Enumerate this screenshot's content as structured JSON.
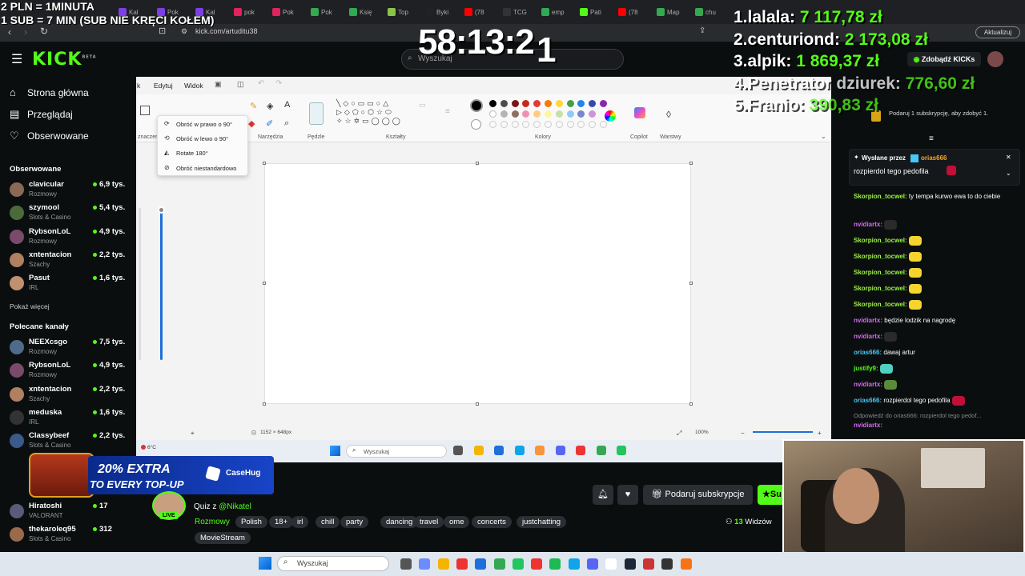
{
  "overlay": {
    "line1": "2 PLN = 1MINUTA",
    "line2": "1 SUB = 7 MIN (SUB NIE KRĘCI KOŁEM)",
    "timer": "58:13:2",
    "timer_last": "1",
    "leaderboard": [
      {
        "rank": "1.",
        "name": "lalala:",
        "value": "7 117,78 zł"
      },
      {
        "rank": "2.",
        "name": "centuriond:",
        "value": "2 173,08 zł"
      },
      {
        "rank": "3.",
        "name": "alpik:",
        "value": "1 869,37 zł"
      },
      {
        "rank": "4.",
        "name": "Penetrator dziurek:",
        "value": "776,60 zł"
      },
      {
        "rank": "5.",
        "name": "Franio:",
        "value": "390,83 zł"
      }
    ]
  },
  "browser": {
    "url": "kick.com/artuditu38",
    "update_label": "Aktualizuj",
    "tabs": [
      {
        "label": "Kal",
        "color": "#7b3fe4"
      },
      {
        "label": "Pok",
        "color": "#7b3fe4"
      },
      {
        "label": "Kal",
        "color": "#7b3fe4"
      },
      {
        "label": "pok",
        "color": "#e0245e"
      },
      {
        "label": "Pok",
        "color": "#e0245e"
      },
      {
        "label": "Pok",
        "color": "#34a853"
      },
      {
        "label": "Księ",
        "color": "#34a853"
      },
      {
        "label": "Top",
        "color": "#8bc34a"
      },
      {
        "label": "Byki",
        "color": "#222222"
      },
      {
        "label": "(78",
        "color": "#ff0000"
      },
      {
        "label": "TCG",
        "color": "#333333"
      },
      {
        "label": "emp",
        "color": "#34a853"
      },
      {
        "label": "Pati",
        "color": "#53fc18"
      },
      {
        "label": "(78",
        "color": "#ff0000"
      },
      {
        "label": "Map",
        "color": "#34a853"
      },
      {
        "label": "chu",
        "color": "#34a853"
      }
    ]
  },
  "kick": {
    "logo": "KICK",
    "logo_beta": "BETA",
    "search_placeholder": "Wyszukaj",
    "kicks_button": "Zdobądź KICKs",
    "nav": [
      {
        "label": "Strona główna",
        "icon": "home-icon"
      },
      {
        "label": "Przeglądaj",
        "icon": "browse-icon"
      },
      {
        "label": "Obserwowane",
        "icon": "heart-icon"
      }
    ],
    "followed_header": "Obserwowane",
    "followed": [
      {
        "name": "clavicular",
        "cat": "Rozmowy",
        "viewers": "6,9 tys.",
        "color": "#8a6a55"
      },
      {
        "name": "szymool",
        "cat": "Slots & Casino",
        "viewers": "5,4 tys.",
        "color": "#4a6a3a"
      },
      {
        "name": "RybsonLoL",
        "cat": "Rozmowy",
        "viewers": "4,9 tys.",
        "color": "#7a4a6a"
      },
      {
        "name": "xntentacion",
        "cat": "Szachy",
        "viewers": "2,2 tys.",
        "color": "#b08060"
      },
      {
        "name": "Pasut",
        "cat": "IRL",
        "viewers": "1,6 tys.",
        "color": "#c09070"
      }
    ],
    "show_more": "Pokaż więcej",
    "recommended_header": "Polecane kanały",
    "recommended": [
      {
        "name": "NEEXcsgo",
        "cat": "Rozmowy",
        "viewers": "7,5 tys.",
        "color": "#506a8a"
      },
      {
        "name": "RybsonLoL",
        "cat": "Rozmowy",
        "viewers": "4,9 tys.",
        "color": "#7a4a6a"
      },
      {
        "name": "xntentacion",
        "cat": "Szachy",
        "viewers": "2,2 tys.",
        "color": "#b08060"
      },
      {
        "name": "meduska",
        "cat": "IRL",
        "viewers": "1,6 tys.",
        "color": "#333333"
      },
      {
        "name": "Classybeef",
        "cat": "Slots & Casino",
        "viewers": "2,2 tys.",
        "color": "#3a5a8a"
      }
    ],
    "more_channels": [
      {
        "name": "Hiratoshi",
        "cat": "VALORANT",
        "viewers": "17",
        "color": "#5a5a7a"
      },
      {
        "name": "thekaroleq95",
        "cat": "Slots & Casino",
        "viewers": "312",
        "color": "#9a6a4a"
      }
    ]
  },
  "paint": {
    "menu": [
      "k",
      "Edytuj",
      "Widok"
    ],
    "sections": [
      "znaczen",
      "Narzędzia",
      "Pędzle",
      "Kształty",
      "Kolory",
      "Copilot",
      "Warstwy"
    ],
    "rotate_menu": [
      "Obróć w prawo o 90°",
      "Obróć w lewo o 90°",
      "Rotate 180°",
      "Obróć niestandardowo"
    ],
    "canvas_size": "1152 × 648px",
    "zoom": "100%",
    "temperature": "6°C",
    "taskbar_search": "Wyszukaj",
    "palette": [
      "#000000",
      "#4d4d4d",
      "#7a1616",
      "#c42b1c",
      "#e53935",
      "#f57c00",
      "#fdd835",
      "#43a047",
      "#1e88e5",
      "#3949ab",
      "#8e24aa",
      "#ffffff",
      "#b4b4b4",
      "#8d6e63",
      "#f48fb1",
      "#ffcc80",
      "#fff59d",
      "#c5e1a5",
      "#90caf9",
      "#7986cb",
      "#ce93d8"
    ]
  },
  "stream": {
    "promo_line1": "20% EXTRA",
    "promo_line2": "TO EVERY TOP-UP",
    "promo_brand": "CaseHug",
    "live": "LIVE",
    "quiz_prefix": "Quiz z ",
    "quiz_handle": "@Nikatel",
    "category": "Rozmowy",
    "tags": [
      "Polish",
      "18+",
      "irl",
      "chill",
      "party",
      "dancing",
      "travel",
      "ome",
      "concerts",
      "justchatting",
      "MovieStream"
    ],
    "viewers_count": "13",
    "viewers_label": " Widzów",
    "gift_label": "Podaruj subskrypcje",
    "sub_label": "Su"
  },
  "chat": {
    "sub_info": "Podaruj 1 subskrypcję, aby zdobyć 1.",
    "pinned_by_prefix": "Wysłane przez ",
    "pinned_by": "orias666",
    "pinned_text": "rozpierdol tego pedofila",
    "messages": [
      {
        "user": "Skorpion_tocwel:",
        "text": " ty tempa kurwo ewa to do ciebie",
        "color": "#9bf542"
      },
      {
        "user": "nvidiartx:",
        "text": "",
        "color": "#d26cf0",
        "emote": "#2a2a2a"
      },
      {
        "user": "Skorpion_tocwel:",
        "text": "",
        "color": "#9bf542",
        "emote": "#f5d430"
      },
      {
        "user": "Skorpion_tocwel:",
        "text": "",
        "color": "#9bf542",
        "emote": "#f5d430"
      },
      {
        "user": "Skorpion_tocwel:",
        "text": "",
        "color": "#9bf542",
        "emote": "#f5d430"
      },
      {
        "user": "Skorpion_tocwel:",
        "text": "",
        "color": "#9bf542",
        "emote": "#f5d430"
      },
      {
        "user": "Skorpion_tocwel:",
        "text": "",
        "color": "#9bf542",
        "emote": "#f5d430"
      },
      {
        "user": "nvidiartx:",
        "text": " będzie lodzik na nagrodę",
        "color": "#d26cf0"
      },
      {
        "user": "nvidiartx:",
        "text": "",
        "color": "#d26cf0",
        "emote": "#2a2a2a"
      },
      {
        "user": "orias666:",
        "text": " dawaj artur",
        "color": "#44c8f5"
      },
      {
        "user": "justify9:",
        "text": "",
        "color": "#53fc18",
        "emote": "#4fd0c0"
      },
      {
        "user": "nvidiartx:",
        "text": "",
        "color": "#d26cf0",
        "emote": "#5a8a3a"
      },
      {
        "user": "orias666:",
        "text": " rozpierdol tego pedofila",
        "color": "#44c8f5",
        "emote": "#c0103a"
      }
    ],
    "reply_text": "Odpowiedź do orias666: rozpierdol tego pedof...",
    "last_user": "nvidiartx:"
  },
  "taskbar": {
    "search": "Wyszukaj"
  }
}
